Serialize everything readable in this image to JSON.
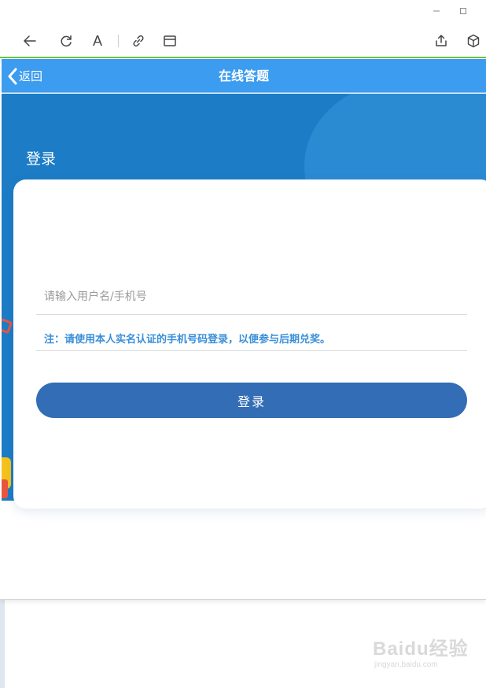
{
  "window": {
    "controls": {
      "minimize_icon": "minimize-icon",
      "maximize_icon": "maximize-icon"
    }
  },
  "toolbar": {
    "font_button_label": "A",
    "icons": [
      "back-arrow-icon",
      "refresh-icon",
      "font-icon",
      "link-icon",
      "window-icon",
      "share-icon",
      "cube-icon"
    ]
  },
  "header": {
    "back_label": "返回",
    "title": "在线答题"
  },
  "banner": {
    "title": "登录"
  },
  "login": {
    "username_placeholder": "请输入用户名/手机号",
    "username_value": "",
    "note": "注：请使用本人实名认证的手机号码登录，以便参与后期兑奖。",
    "submit_label": "登录"
  },
  "watermark": {
    "logo_text": "Baidu经验",
    "url": "jingyan.baidu.com"
  },
  "colors": {
    "header_blue": "#3c9cef",
    "banner_blue": "#1c7cc6",
    "button_blue": "#336db5",
    "note_blue": "#3a8fd9",
    "toolbar_accent_green": "#6cc04a"
  }
}
